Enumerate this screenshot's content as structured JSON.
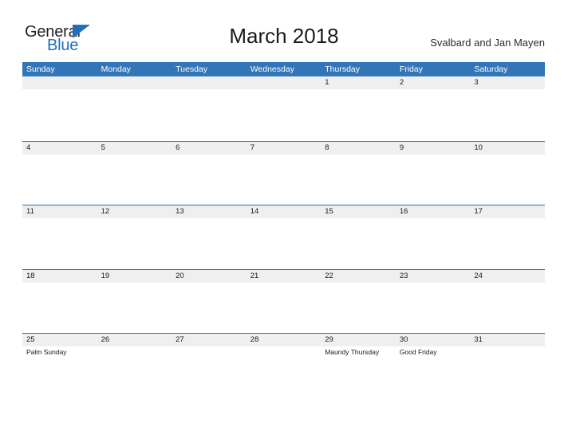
{
  "brand": {
    "name_part1": "General",
    "name_part2": "Blue",
    "accent_color": "#1f6fbd"
  },
  "header": {
    "title": "March 2018",
    "region": "Svalbard and Jan Mayen"
  },
  "calendar": {
    "header_bg": "#3276b8",
    "band_bg": "#efefef",
    "rule_color": "#2f6ead",
    "weekdays": [
      "Sunday",
      "Monday",
      "Tuesday",
      "Wednesday",
      "Thursday",
      "Friday",
      "Saturday"
    ],
    "weeks": [
      [
        {
          "day": "",
          "holiday": ""
        },
        {
          "day": "",
          "holiday": ""
        },
        {
          "day": "",
          "holiday": ""
        },
        {
          "day": "",
          "holiday": ""
        },
        {
          "day": "1",
          "holiday": ""
        },
        {
          "day": "2",
          "holiday": ""
        },
        {
          "day": "3",
          "holiday": ""
        }
      ],
      [
        {
          "day": "4",
          "holiday": ""
        },
        {
          "day": "5",
          "holiday": ""
        },
        {
          "day": "6",
          "holiday": ""
        },
        {
          "day": "7",
          "holiday": ""
        },
        {
          "day": "8",
          "holiday": ""
        },
        {
          "day": "9",
          "holiday": ""
        },
        {
          "day": "10",
          "holiday": ""
        }
      ],
      [
        {
          "day": "11",
          "holiday": ""
        },
        {
          "day": "12",
          "holiday": ""
        },
        {
          "day": "13",
          "holiday": ""
        },
        {
          "day": "14",
          "holiday": ""
        },
        {
          "day": "15",
          "holiday": ""
        },
        {
          "day": "16",
          "holiday": ""
        },
        {
          "day": "17",
          "holiday": ""
        }
      ],
      [
        {
          "day": "18",
          "holiday": ""
        },
        {
          "day": "19",
          "holiday": ""
        },
        {
          "day": "20",
          "holiday": ""
        },
        {
          "day": "21",
          "holiday": ""
        },
        {
          "day": "22",
          "holiday": ""
        },
        {
          "day": "23",
          "holiday": ""
        },
        {
          "day": "24",
          "holiday": ""
        }
      ],
      [
        {
          "day": "25",
          "holiday": "Palm Sunday"
        },
        {
          "day": "26",
          "holiday": ""
        },
        {
          "day": "27",
          "holiday": ""
        },
        {
          "day": "28",
          "holiday": ""
        },
        {
          "day": "29",
          "holiday": "Maundy Thursday"
        },
        {
          "day": "30",
          "holiday": "Good Friday"
        },
        {
          "day": "31",
          "holiday": ""
        }
      ]
    ]
  }
}
